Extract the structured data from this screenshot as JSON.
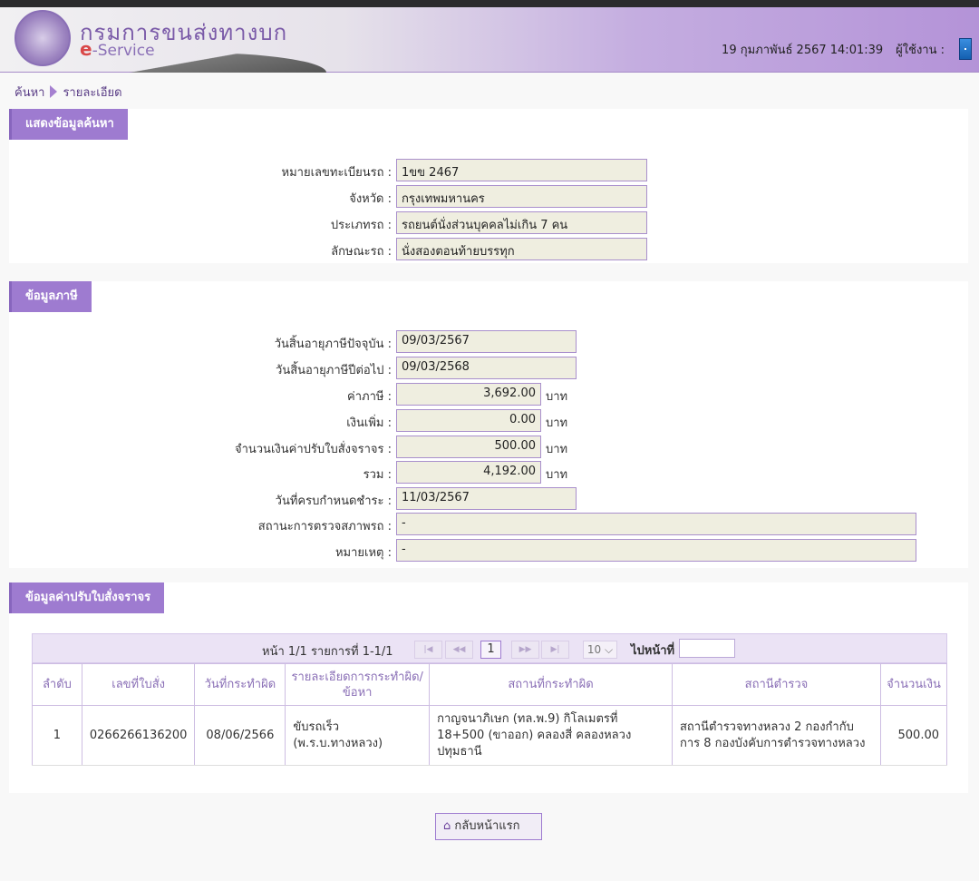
{
  "header": {
    "logo_th": "กรมการขนส่งทางบก",
    "logo_e": "e",
    "logo_service": "-Service",
    "datetime": "19 กุมภาพันธ์ 2567 14:01:39",
    "user_label": "ผู้ใช้งาน :"
  },
  "breadcrumb": [
    "ค้นหา",
    "รายละเอียด"
  ],
  "search_section": {
    "title": "แสดงข้อมูลค้นหา",
    "fields": [
      {
        "label": "หมายเลขทะเบียนรถ :",
        "value": "1ขข 2467"
      },
      {
        "label": "จังหวัด :",
        "value": "กรุงเทพมหานคร"
      },
      {
        "label": "ประเภทรถ :",
        "value": "รถยนต์นั่งส่วนบุคคลไม่เกิน 7 คน"
      },
      {
        "label": "ลักษณะรถ :",
        "value": "นั่งสองตอนท้ายบรรทุก"
      }
    ]
  },
  "tax_section": {
    "title": "ข้อมูลภาษี",
    "unit": "บาท",
    "fields": [
      {
        "label": "วันสิ้นอายุภาษีปัจจุบัน :",
        "value": "09/03/2567"
      },
      {
        "label": "วันสิ้นอายุภาษีปีต่อไป :",
        "value": "09/03/2568"
      },
      {
        "label": "ค่าภาษี :",
        "value": "3,692.00"
      },
      {
        "label": "เงินเพิ่ม :",
        "value": "0.00"
      },
      {
        "label": "จำนวนเงินค่าปรับใบสั่งจราจร :",
        "value": "500.00"
      },
      {
        "label": "รวม :",
        "value": "4,192.00"
      },
      {
        "label": "วันที่ครบกำหนดชำระ :",
        "value": "11/03/2567"
      },
      {
        "label": "สถานะการตรวจสภาพรถ :",
        "value": "-"
      },
      {
        "label": "หมายเหตุ :",
        "value": "-"
      }
    ]
  },
  "fine_section": {
    "title": "ข้อมูลค่าปรับใบสั่งจราจร",
    "pager": {
      "info": "หน้า 1/1 รายการที่ 1-1/1",
      "current_page": "1",
      "page_size": "10",
      "goto_label": "ไปหน้าที่",
      "goto_value": ""
    },
    "columns": [
      "ลำดับ",
      "เลขที่ใบสั่ง",
      "วันที่กระทำผิด",
      "รายละเอียดการกระทำผิด/ข้อหา",
      "สถานที่กระทำผิด",
      "สถานีตำรวจ",
      "จำนวนเงิน"
    ],
    "rows": [
      [
        "1",
        "0266266136200",
        "08/06/2566",
        "ขับรถเร็ว (พ.ร.บ.ทางหลวง)",
        "กาญจนาภิเษก (ทล.พ.9) กิโลเมตรที่ 18+500 (ขาออก) คลองสี่ คลองหลวง ปทุมธานี",
        "สถานีตำรวจทางหลวง 2 กองกำกับการ 8 กองบังคับการตำรวจทางหลวง",
        "500.00"
      ]
    ]
  },
  "back_button": "กลับหน้าแรก"
}
